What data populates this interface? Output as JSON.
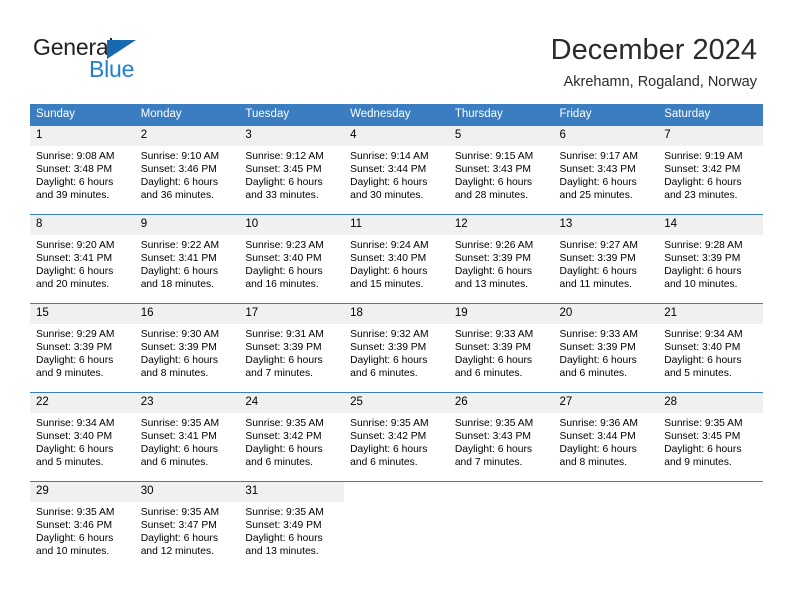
{
  "brand": {
    "name_top": "General",
    "name_bottom": "Blue",
    "triangle_color": "#1769b0",
    "blue_color": "#1f7fd0"
  },
  "header": {
    "title": "December 2024",
    "subtitle": "Akrehamn, Rogaland, Norway"
  },
  "theme": {
    "header_bg": "#3a7dc0",
    "daynum_bg": "#f0f0f0",
    "rule_color": "#3a7dc0",
    "text_color": "#000000"
  },
  "weekdays": [
    "Sunday",
    "Monday",
    "Tuesday",
    "Wednesday",
    "Thursday",
    "Friday",
    "Saturday"
  ],
  "labels": {
    "sunrise_prefix": "Sunrise:",
    "sunset_prefix": "Sunset:",
    "daylight_prefix": "Daylight:"
  },
  "weeks": [
    [
      {
        "day": "1",
        "l1": "Sunrise: 9:08 AM",
        "l2": "Sunset: 3:48 PM",
        "l3": "Daylight: 6 hours",
        "l4": "and 39 minutes."
      },
      {
        "day": "2",
        "l1": "Sunrise: 9:10 AM",
        "l2": "Sunset: 3:46 PM",
        "l3": "Daylight: 6 hours",
        "l4": "and 36 minutes."
      },
      {
        "day": "3",
        "l1": "Sunrise: 9:12 AM",
        "l2": "Sunset: 3:45 PM",
        "l3": "Daylight: 6 hours",
        "l4": "and 33 minutes."
      },
      {
        "day": "4",
        "l1": "Sunrise: 9:14 AM",
        "l2": "Sunset: 3:44 PM",
        "l3": "Daylight: 6 hours",
        "l4": "and 30 minutes."
      },
      {
        "day": "5",
        "l1": "Sunrise: 9:15 AM",
        "l2": "Sunset: 3:43 PM",
        "l3": "Daylight: 6 hours",
        "l4": "and 28 minutes."
      },
      {
        "day": "6",
        "l1": "Sunrise: 9:17 AM",
        "l2": "Sunset: 3:43 PM",
        "l3": "Daylight: 6 hours",
        "l4": "and 25 minutes."
      },
      {
        "day": "7",
        "l1": "Sunrise: 9:19 AM",
        "l2": "Sunset: 3:42 PM",
        "l3": "Daylight: 6 hours",
        "l4": "and 23 minutes."
      }
    ],
    [
      {
        "day": "8",
        "l1": "Sunrise: 9:20 AM",
        "l2": "Sunset: 3:41 PM",
        "l3": "Daylight: 6 hours",
        "l4": "and 20 minutes."
      },
      {
        "day": "9",
        "l1": "Sunrise: 9:22 AM",
        "l2": "Sunset: 3:41 PM",
        "l3": "Daylight: 6 hours",
        "l4": "and 18 minutes."
      },
      {
        "day": "10",
        "l1": "Sunrise: 9:23 AM",
        "l2": "Sunset: 3:40 PM",
        "l3": "Daylight: 6 hours",
        "l4": "and 16 minutes."
      },
      {
        "day": "11",
        "l1": "Sunrise: 9:24 AM",
        "l2": "Sunset: 3:40 PM",
        "l3": "Daylight: 6 hours",
        "l4": "and 15 minutes."
      },
      {
        "day": "12",
        "l1": "Sunrise: 9:26 AM",
        "l2": "Sunset: 3:39 PM",
        "l3": "Daylight: 6 hours",
        "l4": "and 13 minutes."
      },
      {
        "day": "13",
        "l1": "Sunrise: 9:27 AM",
        "l2": "Sunset: 3:39 PM",
        "l3": "Daylight: 6 hours",
        "l4": "and 11 minutes."
      },
      {
        "day": "14",
        "l1": "Sunrise: 9:28 AM",
        "l2": "Sunset: 3:39 PM",
        "l3": "Daylight: 6 hours",
        "l4": "and 10 minutes."
      }
    ],
    [
      {
        "day": "15",
        "l1": "Sunrise: 9:29 AM",
        "l2": "Sunset: 3:39 PM",
        "l3": "Daylight: 6 hours",
        "l4": "and 9 minutes."
      },
      {
        "day": "16",
        "l1": "Sunrise: 9:30 AM",
        "l2": "Sunset: 3:39 PM",
        "l3": "Daylight: 6 hours",
        "l4": "and 8 minutes."
      },
      {
        "day": "17",
        "l1": "Sunrise: 9:31 AM",
        "l2": "Sunset: 3:39 PM",
        "l3": "Daylight: 6 hours",
        "l4": "and 7 minutes."
      },
      {
        "day": "18",
        "l1": "Sunrise: 9:32 AM",
        "l2": "Sunset: 3:39 PM",
        "l3": "Daylight: 6 hours",
        "l4": "and 6 minutes."
      },
      {
        "day": "19",
        "l1": "Sunrise: 9:33 AM",
        "l2": "Sunset: 3:39 PM",
        "l3": "Daylight: 6 hours",
        "l4": "and 6 minutes."
      },
      {
        "day": "20",
        "l1": "Sunrise: 9:33 AM",
        "l2": "Sunset: 3:39 PM",
        "l3": "Daylight: 6 hours",
        "l4": "and 6 minutes."
      },
      {
        "day": "21",
        "l1": "Sunrise: 9:34 AM",
        "l2": "Sunset: 3:40 PM",
        "l3": "Daylight: 6 hours",
        "l4": "and 5 minutes."
      }
    ],
    [
      {
        "day": "22",
        "l1": "Sunrise: 9:34 AM",
        "l2": "Sunset: 3:40 PM",
        "l3": "Daylight: 6 hours",
        "l4": "and 5 minutes."
      },
      {
        "day": "23",
        "l1": "Sunrise: 9:35 AM",
        "l2": "Sunset: 3:41 PM",
        "l3": "Daylight: 6 hours",
        "l4": "and 6 minutes."
      },
      {
        "day": "24",
        "l1": "Sunrise: 9:35 AM",
        "l2": "Sunset: 3:42 PM",
        "l3": "Daylight: 6 hours",
        "l4": "and 6 minutes."
      },
      {
        "day": "25",
        "l1": "Sunrise: 9:35 AM",
        "l2": "Sunset: 3:42 PM",
        "l3": "Daylight: 6 hours",
        "l4": "and 6 minutes."
      },
      {
        "day": "26",
        "l1": "Sunrise: 9:35 AM",
        "l2": "Sunset: 3:43 PM",
        "l3": "Daylight: 6 hours",
        "l4": "and 7 minutes."
      },
      {
        "day": "27",
        "l1": "Sunrise: 9:36 AM",
        "l2": "Sunset: 3:44 PM",
        "l3": "Daylight: 6 hours",
        "l4": "and 8 minutes."
      },
      {
        "day": "28",
        "l1": "Sunrise: 9:35 AM",
        "l2": "Sunset: 3:45 PM",
        "l3": "Daylight: 6 hours",
        "l4": "and 9 minutes."
      }
    ],
    [
      {
        "day": "29",
        "l1": "Sunrise: 9:35 AM",
        "l2": "Sunset: 3:46 PM",
        "l3": "Daylight: 6 hours",
        "l4": "and 10 minutes."
      },
      {
        "day": "30",
        "l1": "Sunrise: 9:35 AM",
        "l2": "Sunset: 3:47 PM",
        "l3": "Daylight: 6 hours",
        "l4": "and 12 minutes."
      },
      {
        "day": "31",
        "l1": "Sunrise: 9:35 AM",
        "l2": "Sunset: 3:49 PM",
        "l3": "Daylight: 6 hours",
        "l4": "and 13 minutes."
      },
      {
        "day": "",
        "l1": "",
        "l2": "",
        "l3": "",
        "l4": ""
      },
      {
        "day": "",
        "l1": "",
        "l2": "",
        "l3": "",
        "l4": ""
      },
      {
        "day": "",
        "l1": "",
        "l2": "",
        "l3": "",
        "l4": ""
      },
      {
        "day": "",
        "l1": "",
        "l2": "",
        "l3": "",
        "l4": ""
      }
    ]
  ]
}
